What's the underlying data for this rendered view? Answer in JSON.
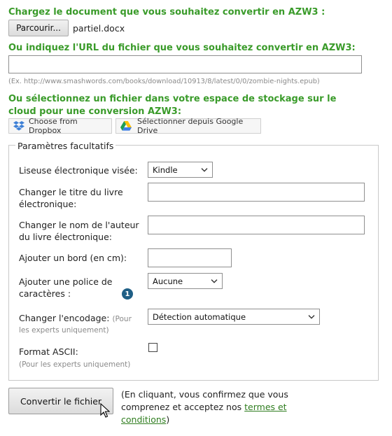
{
  "upload": {
    "heading": "Chargez le document que vous souhaitez convertir en AZW3 :",
    "browse_label": "Parcourir...",
    "file_name": "partiel.docx"
  },
  "url": {
    "heading": "Ou indiquez l'URL du fichier que vous souhaitez convertir en AZW3:",
    "value": "",
    "example": "(Ex. http://www.smashwords.com/books/download/10913/8/latest/0/0/zombie-nights.epub)"
  },
  "cloud": {
    "heading_line1": "Ou sélectionnez un fichier dans votre espace de stockage sur le",
    "heading_line2": "cloud pour une conversion AZW3:",
    "dropbox_label": "Choose from Dropbox",
    "gdrive_label": "Sélectionner depuis Google Drive",
    "dropbox_color": "#3d7fd6",
    "icons": [
      "dropbox-icon",
      "google-drive-icon"
    ]
  },
  "options": {
    "legend": "Paramètres facultatifs",
    "reader_label": "Liseuse électronique visée:",
    "reader_value": "Kindle",
    "title_label_1": "Changer le titre du livre",
    "title_label_2": "électronique:",
    "title_value": "",
    "author_label_1": "Changer le nom de l'auteur",
    "author_label_2": "du livre électronique:",
    "author_value": "",
    "border_label": "Ajouter un bord (en cm):",
    "border_value": "",
    "font_label_1": "Ajouter une police de",
    "font_label_2": "caractères :",
    "font_value": "Aucune",
    "info_icon_text": "1",
    "encoding_label": "Changer l'encodage:",
    "encoding_hint_1": "(Pour",
    "encoding_hint_2": "les experts uniquement)",
    "encoding_value": "Détection automatique",
    "ascii_label": "Format ASCII:",
    "ascii_hint": "(Pour les experts uniquement)",
    "ascii_checked": false
  },
  "submit": {
    "button_label": "Convertir le fichier",
    "note_1": "(En cliquant, vous confirmez que vous",
    "note_2_prefix": "comprenez et acceptez nos ",
    "terms_part1": "termes et",
    "terms_part2": "conditions",
    "note_end": ")"
  },
  "colors": {
    "heading_green": "#3a9b2a",
    "link_green": "#2f7d1f",
    "info_blue": "#1f5f86"
  }
}
